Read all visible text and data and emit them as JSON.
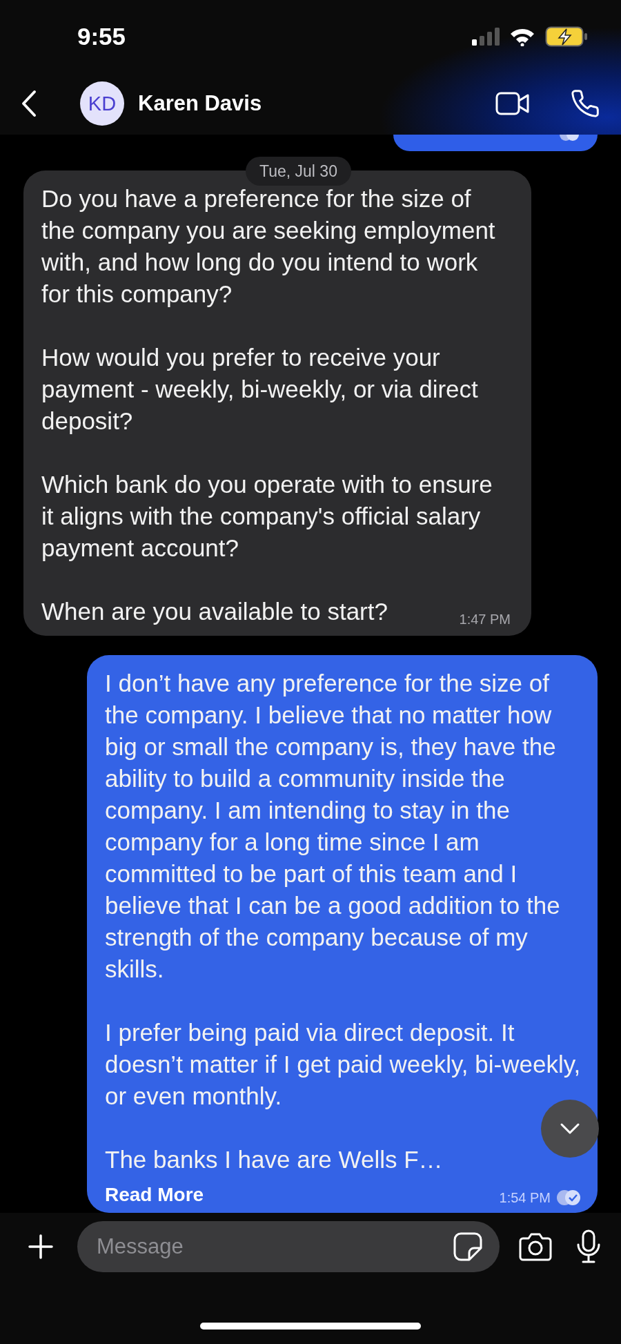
{
  "status_bar": {
    "time": "9:55"
  },
  "header": {
    "avatar_initials": "KD",
    "contact_name": "Karen Davis"
  },
  "clipped_message": {
    "kind": "outgoing",
    "read": true
  },
  "date_divider": "Tue, Jul 30",
  "messages": [
    {
      "kind": "incoming",
      "paragraphs": [
        "Do you have a preference for the size of the company you are seeking employment with, and how long do you intend to work for this company?",
        "How would you prefer to receive your payment - weekly, bi-weekly, or via direct deposit?",
        "Which bank do you operate with to ensure it aligns with the company's official salary payment account?",
        "When are you available to start?"
      ],
      "time": "1:47 PM"
    },
    {
      "kind": "outgoing",
      "paragraphs": [
        "I don’t have any preference for the size of the company. I believe that no matter how big or small the company is, they have the ability to build a community inside the company. I am intending to stay in the company for a long time since I am committed to be part of this team and I believe that I can be a good addition to the strength of the company because of my skills.",
        "I prefer being paid via direct deposit. It doesn’t matter if I get paid weekly, bi-weekly, or even monthly.",
        "The banks I have are Wells F…"
      ],
      "read_more": "Read More",
      "time": "1:54 PM",
      "read": true
    }
  ],
  "composer": {
    "placeholder": "Message"
  }
}
